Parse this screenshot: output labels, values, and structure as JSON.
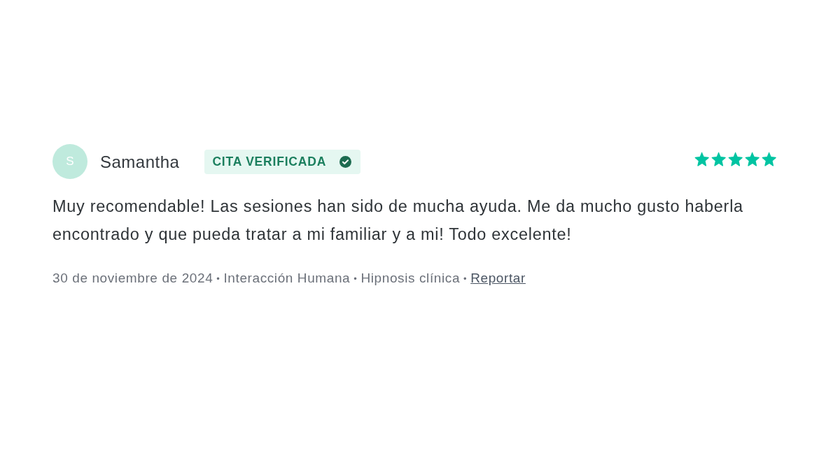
{
  "review": {
    "avatar": {
      "initial": "S"
    },
    "author": "Samantha",
    "badge": {
      "label": "CITA VERIFICADA"
    },
    "stars": 5,
    "text": "Muy recomendable! Las sesiones han sido de mucha ayuda. Me da mucho gusto haberla encontrado y que pueda tratar a mi familiar y a mi! Todo excelente!",
    "meta": [
      {
        "kind": "text",
        "text": "30 de noviembre de 2024"
      },
      {
        "kind": "separator",
        "text": "•"
      },
      {
        "kind": "text",
        "text": "Interacción Humana"
      },
      {
        "kind": "separator",
        "text": "•"
      },
      {
        "kind": "text",
        "text": "Hipnosis clínica"
      },
      {
        "kind": "separator",
        "text": "•"
      },
      {
        "kind": "link",
        "text": "Reportar"
      }
    ]
  }
}
